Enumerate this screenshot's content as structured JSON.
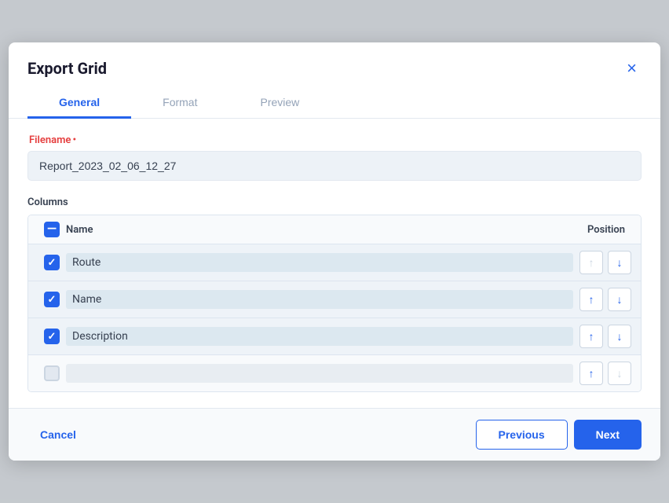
{
  "modal": {
    "title": "Export Grid",
    "close_label": "×"
  },
  "tabs": [
    {
      "id": "general",
      "label": "General",
      "active": true
    },
    {
      "id": "format",
      "label": "Format",
      "active": false
    },
    {
      "id": "preview",
      "label": "Preview",
      "active": false
    }
  ],
  "form": {
    "filename_label": "Filename",
    "filename_required": "•",
    "filename_value": "Report_2023_02_06_12_27",
    "columns_label": "Columns",
    "header": {
      "name": "Name",
      "position": "Position"
    },
    "columns": [
      {
        "id": "route",
        "name": "Route",
        "checked": true,
        "up_disabled": true,
        "down_disabled": false
      },
      {
        "id": "name",
        "name": "Name",
        "checked": true,
        "up_disabled": false,
        "down_disabled": false
      },
      {
        "id": "description",
        "name": "Description",
        "checked": true,
        "up_disabled": false,
        "down_disabled": false
      },
      {
        "id": "empty",
        "name": "",
        "checked": false,
        "up_disabled": false,
        "down_disabled": true
      }
    ]
  },
  "footer": {
    "cancel_label": "Cancel",
    "previous_label": "Previous",
    "next_label": "Next"
  },
  "icons": {
    "up_arrow": "↑",
    "down_arrow": "↓",
    "checkmark": "✓",
    "indeterminate": "—"
  }
}
